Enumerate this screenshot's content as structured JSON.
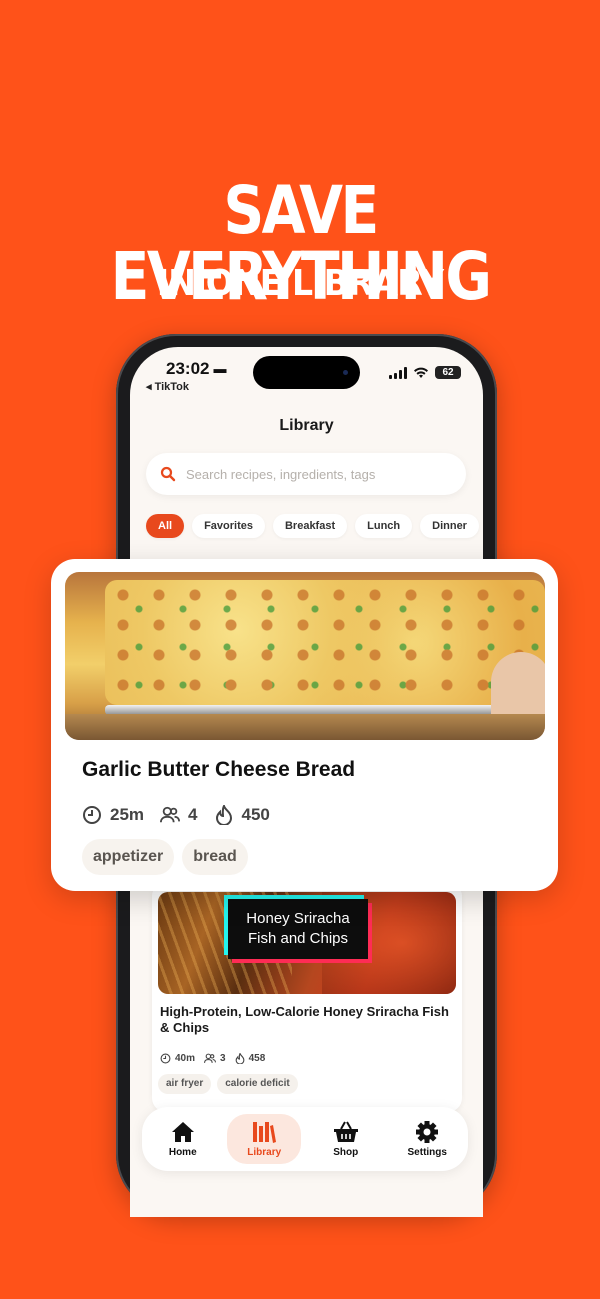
{
  "headline": "SAVE EVERYTHING",
  "subheadline": "IN ONE LIBRARY",
  "status": {
    "time": "23:02",
    "back_app": "◂ TikTok",
    "battery": "62"
  },
  "page_title": "Library",
  "search": {
    "placeholder": "Search recipes, ingredients, tags"
  },
  "filters": [
    "All",
    "Favorites",
    "Breakfast",
    "Lunch",
    "Dinner"
  ],
  "active_filter": "All",
  "featured": {
    "title": "Garlic Butter Cheese Bread",
    "time": "25m",
    "servings": "4",
    "calories": "450",
    "tags": [
      "appetizer",
      "bread"
    ]
  },
  "recipe2": {
    "overlay_line1": "Honey Sriracha",
    "overlay_line2": "Fish and Chips",
    "title": "High-Protein, Low-Calorie Honey Sriracha Fish & Chips",
    "time": "40m",
    "servings": "3",
    "calories": "458",
    "tags": [
      "air fryer",
      "calorie deficit"
    ]
  },
  "tabs": [
    {
      "label": "Home",
      "icon": "home-icon"
    },
    {
      "label": "Library",
      "icon": "library-icon"
    },
    {
      "label": "Shop",
      "icon": "basket-icon"
    },
    {
      "label": "Settings",
      "icon": "gear-icon"
    }
  ],
  "active_tab": "Library",
  "colors": {
    "background": "#FF5219",
    "accent": "#E8491D",
    "screen": "#FBF7F3"
  }
}
